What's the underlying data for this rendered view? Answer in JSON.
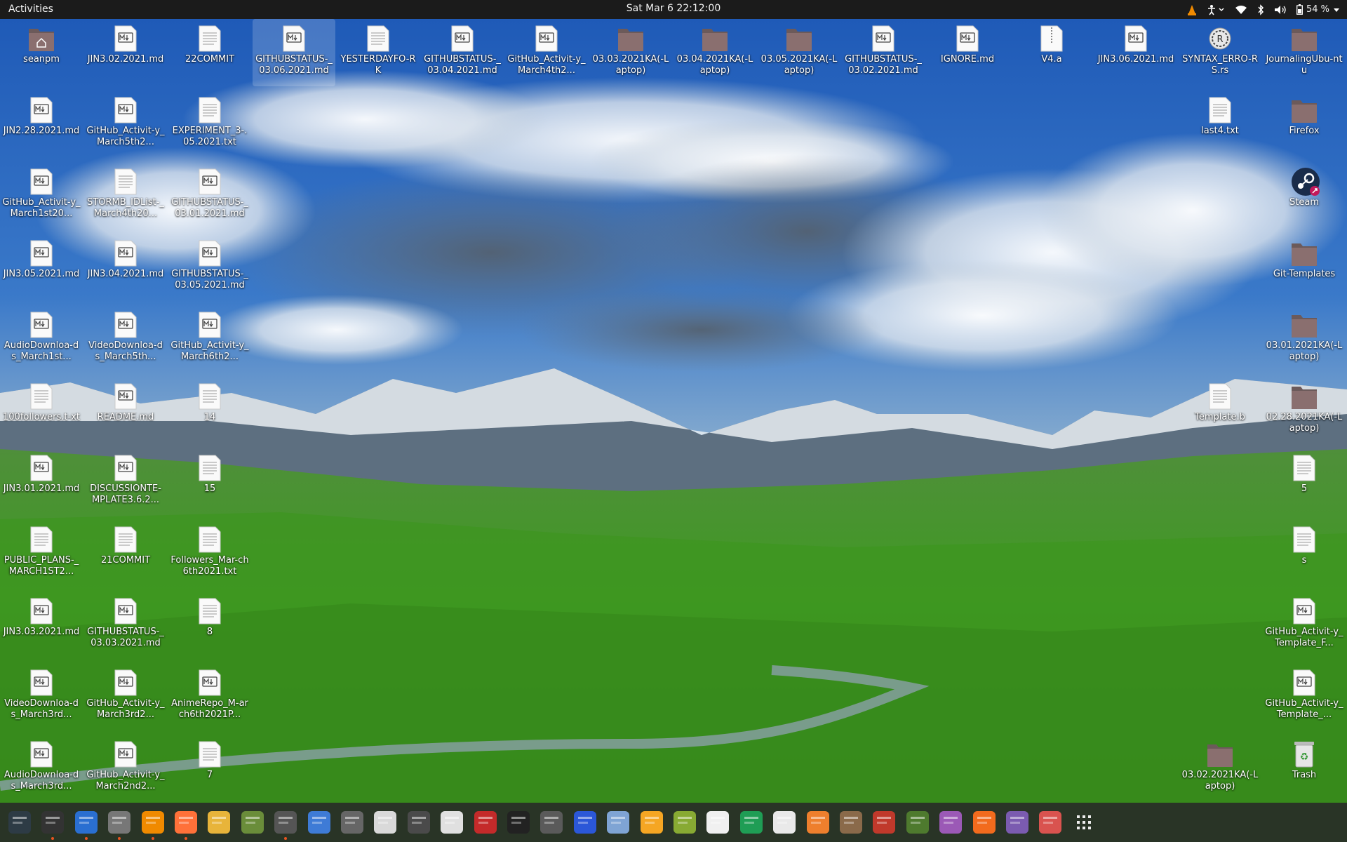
{
  "topbar": {
    "activities": "Activities",
    "datetime": "Sat Mar 6  22:12:00",
    "battery": "54 %"
  },
  "desktop_icons": [
    {
      "label": "seanpm",
      "type": "home"
    },
    {
      "label": "JIN3.02.2021.md",
      "type": "md"
    },
    {
      "label": "22COMMIT",
      "type": "txt"
    },
    {
      "label": "GITHUBSTATUS-_03.06.2021.md",
      "type": "md",
      "selected": true
    },
    {
      "label": "YESTERDAYFO-RK",
      "type": "txt"
    },
    {
      "label": "GITHUBSTATUS-_03.04.2021.md",
      "type": "md"
    },
    {
      "label": "GitHub_Activit-y_March4th2...",
      "type": "md"
    },
    {
      "label": "03.03.2021KA(-Laptop)",
      "type": "folder"
    },
    {
      "label": "03.04.2021KA(-Laptop)",
      "type": "folder"
    },
    {
      "label": "03.05.2021KA(-Laptop)",
      "type": "folder"
    },
    {
      "label": "GITHUBSTATUS-_03.02.2021.md",
      "type": "md"
    },
    {
      "label": "IGNORE.md",
      "type": "md"
    },
    {
      "label": "V4.a",
      "type": "zip"
    },
    {
      "label": "JIN3.06.2021.md",
      "type": "md"
    },
    {
      "label": "SYNTAX_ERRO-RS.rs",
      "type": "rs"
    },
    {
      "label": "JournalingUbu-ntu",
      "type": "folder"
    },
    {
      "label": "JIN2.28.2021.md",
      "type": "md"
    },
    {
      "label": "GitHub_Activit-y_March5th2...",
      "type": "md"
    },
    {
      "label": "EXPERIMENT_3-.05.2021.txt",
      "type": "txt"
    },
    {
      "label": "last4.txt",
      "type": "txt"
    },
    {
      "label": "Firefox",
      "type": "folder"
    },
    {
      "label": "GitHub_Activit-y_March1st20...",
      "type": "md"
    },
    {
      "label": "STORMB_IDList-_March4th20...",
      "type": "txt"
    },
    {
      "label": "GITHUBSTATUS-_03.01.2021.md",
      "type": "md"
    },
    {
      "label": "Steam",
      "type": "steam"
    },
    {
      "label": "JIN3.05.2021.md",
      "type": "md"
    },
    {
      "label": "JIN3.04.2021.md",
      "type": "md"
    },
    {
      "label": "GITHUBSTATUS-_03.05.2021.md",
      "type": "md"
    },
    {
      "label": "Git-Templates",
      "type": "folder"
    },
    {
      "label": "AudioDownloa-ds_March1st...",
      "type": "md"
    },
    {
      "label": "VideoDownloa-ds_March5th...",
      "type": "md"
    },
    {
      "label": "GitHub_Activit-y_March6th2...",
      "type": "md"
    },
    {
      "label": "03.01.2021KA(-Laptop)",
      "type": "folder"
    },
    {
      "label": "100followers.t-xt",
      "type": "txt"
    },
    {
      "label": "README.md",
      "type": "md"
    },
    {
      "label": "14",
      "type": "txt"
    },
    {
      "label": "Template.b",
      "type": "txt"
    },
    {
      "label": "02.28.2021KA(-Laptop)",
      "type": "folder"
    },
    {
      "label": "JIN3.01.2021.md",
      "type": "md"
    },
    {
      "label": "DISCUSSIONTE-MPLATE3.6.2...",
      "type": "md"
    },
    {
      "label": "15",
      "type": "txt"
    },
    {
      "label": "5",
      "type": "txt"
    },
    {
      "label": "PUBLIC_PLANS-_MARCH1ST2...",
      "type": "txt"
    },
    {
      "label": "21COMMIT",
      "type": "txt"
    },
    {
      "label": "Followers_Mar-ch6th2021.txt",
      "type": "txt"
    },
    {
      "label": "s",
      "type": "txt"
    },
    {
      "label": "JIN3.03.2021.md",
      "type": "md"
    },
    {
      "label": "GITHUBSTATUS-_03.03.2021.md",
      "type": "md"
    },
    {
      "label": "8",
      "type": "txt"
    },
    {
      "label": "GitHub_Activit-y_Template_F...",
      "type": "md"
    },
    {
      "label": "VideoDownloa-ds_March3rd...",
      "type": "md"
    },
    {
      "label": "GitHub_Activit-y_March3rd2...",
      "type": "md"
    },
    {
      "label": "AnimeRepo_M-arch6th2021P...",
      "type": "md"
    },
    {
      "label": "GitHub_Activit-y_Template_...",
      "type": "md"
    },
    {
      "label": "AudioDownloa-ds_March3rd...",
      "type": "md"
    },
    {
      "label": "GitHub_Activit-y_March2nd2...",
      "type": "md"
    },
    {
      "label": "7",
      "type": "txt"
    },
    {
      "label": "03.02.2021KA(-Laptop)",
      "type": "folder"
    },
    {
      "label": "Trash",
      "type": "trash"
    }
  ],
  "dock_apps": [
    {
      "name": "system-monitor-icon",
      "running": false
    },
    {
      "name": "terminal-icon",
      "running": true
    },
    {
      "name": "text-editor-icon",
      "running": true
    },
    {
      "name": "files-icon",
      "running": true
    },
    {
      "name": "vlc-icon",
      "running": true
    },
    {
      "name": "firefox-icon",
      "running": true
    },
    {
      "name": "notes-icon",
      "running": false
    },
    {
      "name": "puzzle-icon",
      "running": false
    },
    {
      "name": "settings-icon",
      "running": true
    },
    {
      "name": "document-viewer-icon",
      "running": false
    },
    {
      "name": "search-icon",
      "running": false
    },
    {
      "name": "audio-editor-icon",
      "running": false
    },
    {
      "name": "software-updater-icon",
      "running": false
    },
    {
      "name": "image-viewer-icon",
      "running": false
    },
    {
      "name": "game-controller-icon",
      "running": false
    },
    {
      "name": "inkscape-icon",
      "running": false
    },
    {
      "name": "clock-icon",
      "running": false
    },
    {
      "name": "screenshot-icon",
      "running": false
    },
    {
      "name": "virtualbox-icon",
      "running": false
    },
    {
      "name": "blender-icon",
      "running": false
    },
    {
      "name": "image-editor-icon",
      "running": false
    },
    {
      "name": "character-map-icon",
      "running": false
    },
    {
      "name": "spreadsheet-icon",
      "running": false
    },
    {
      "name": "typing-icon",
      "running": false
    },
    {
      "name": "presentation-icon",
      "running": false
    },
    {
      "name": "gimp-icon",
      "running": false
    },
    {
      "name": "mario-icon",
      "running": false
    },
    {
      "name": "minecraft-icon",
      "running": false
    },
    {
      "name": "tweaks-icon",
      "running": false
    },
    {
      "name": "software-center-icon",
      "running": false
    },
    {
      "name": "camera-icon",
      "running": false
    },
    {
      "name": "disk-usage-icon",
      "running": false
    },
    {
      "name": "show-apps-icon",
      "running": false
    }
  ]
}
